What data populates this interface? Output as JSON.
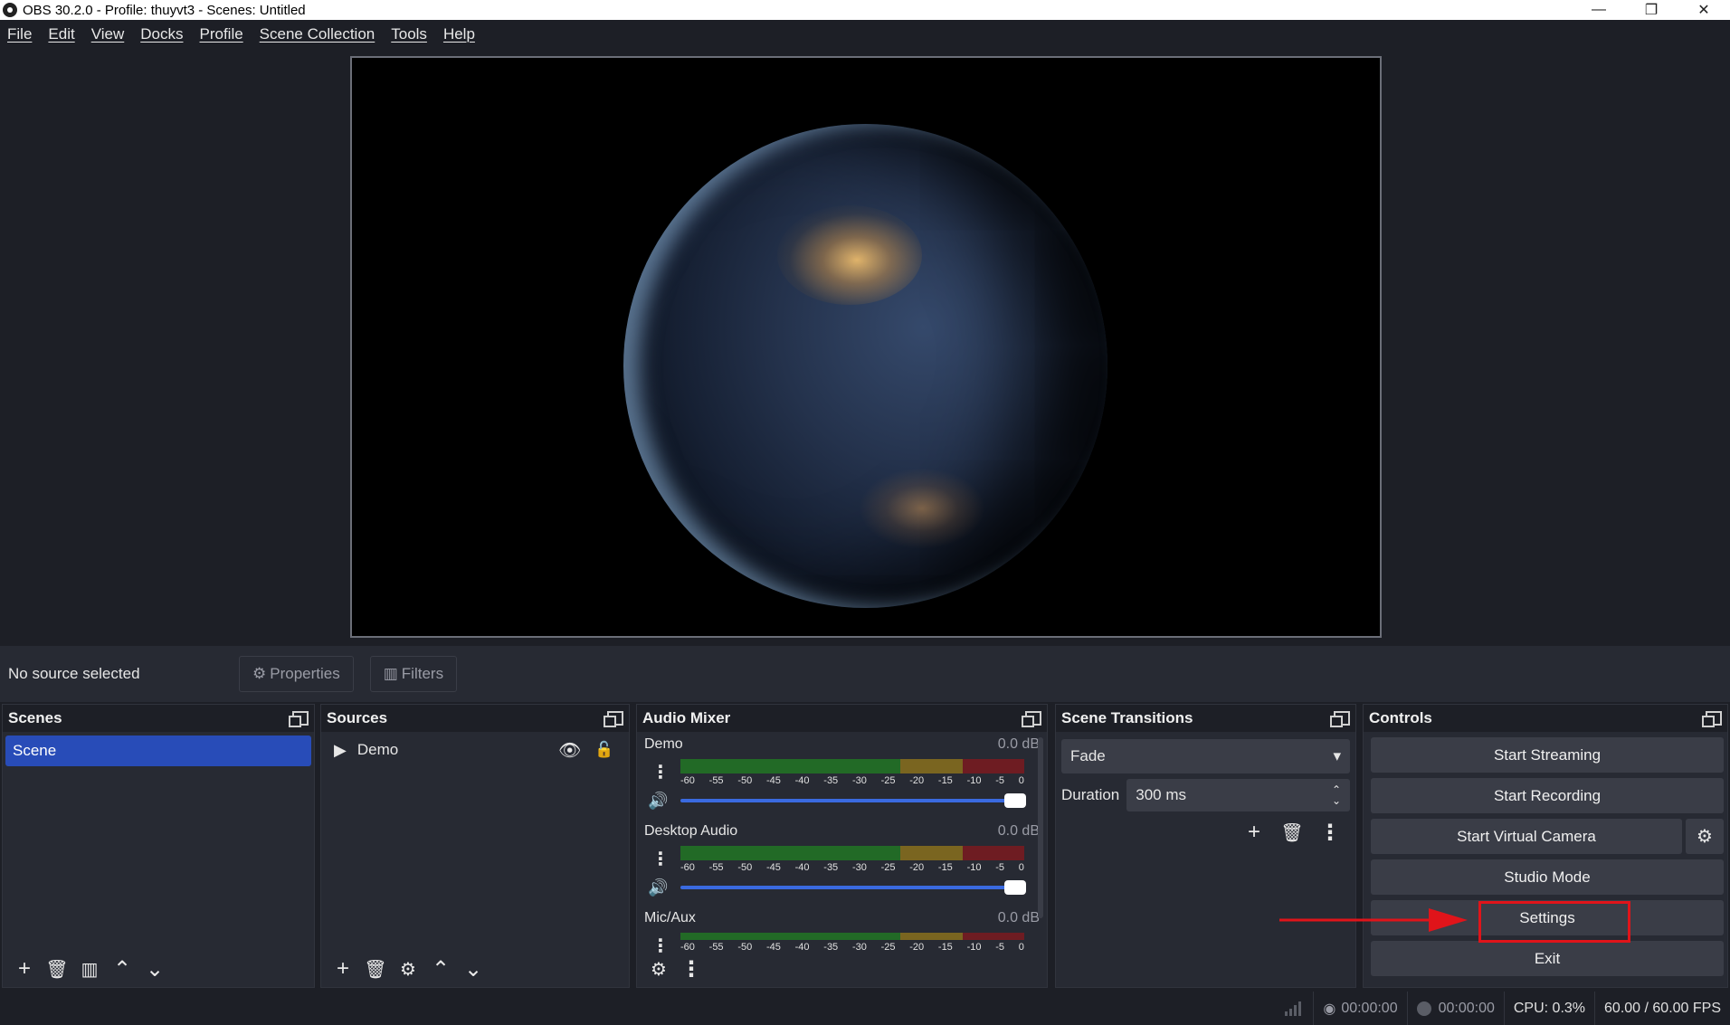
{
  "window": {
    "title": "OBS 30.2.0 - Profile: thuyvt3 - Scenes: Untitled",
    "minimize_glyph": "—",
    "restore_glyph": "❐",
    "close_glyph": "✕"
  },
  "menu": [
    "File",
    "Edit",
    "View",
    "Docks",
    "Profile",
    "Scene Collection",
    "Tools",
    "Help"
  ],
  "source_toolbar": {
    "status": "No source selected",
    "properties_label": "Properties",
    "filters_label": "Filters"
  },
  "docks": {
    "scenes": {
      "title": "Scenes",
      "items": [
        "Scene"
      ]
    },
    "sources": {
      "title": "Sources",
      "items": [
        "Demo"
      ]
    },
    "audio_mixer": {
      "title": "Audio Mixer",
      "ticks": [
        "-60",
        "-55",
        "-50",
        "-45",
        "-40",
        "-35",
        "-30",
        "-25",
        "-20",
        "-15",
        "-10",
        "-5",
        "0"
      ],
      "channels": [
        {
          "name": "Demo",
          "db": "0.0 dB"
        },
        {
          "name": "Desktop Audio",
          "db": "0.0 dB"
        },
        {
          "name": "Mic/Aux",
          "db": "0.0 dB"
        }
      ]
    },
    "scene_transitions": {
      "title": "Scene Transitions",
      "transition": "Fade",
      "duration_label": "Duration",
      "duration_value": "300 ms"
    },
    "controls": {
      "title": "Controls",
      "start_streaming": "Start Streaming",
      "start_recording": "Start Recording",
      "start_virtual_camera": "Start Virtual Camera",
      "studio_mode": "Studio Mode",
      "settings": "Settings",
      "exit": "Exit"
    }
  },
  "status_bar": {
    "stream_time": "00:00:00",
    "record_time": "00:00:00",
    "cpu": "CPU: 0.3%",
    "fps": "60.00 / 60.00 FPS"
  },
  "annotation": {
    "color": "#e0141a"
  }
}
